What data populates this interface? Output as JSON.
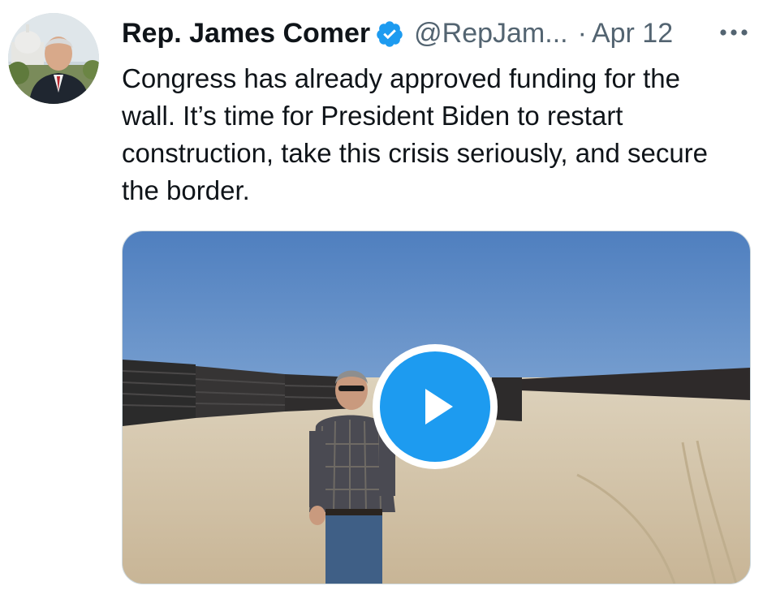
{
  "tweet": {
    "display_name": "Rep. James Comer",
    "handle": "@RepJam...",
    "separator": "·",
    "date": "Apr 12",
    "text": "Congress has already approved funding for the\nwall. It’s time for President Biden to restart\nconstruction, take this crisis seriously, and secure\nthe border.",
    "media": {
      "type": "video",
      "play_icon": "play-icon"
    }
  },
  "icons": {
    "verified": "verified-badge-icon",
    "more": "more-options-icon"
  },
  "colors": {
    "accent": "#1d9bf0",
    "secondary_text": "#536471",
    "primary_text": "#0f1419"
  }
}
